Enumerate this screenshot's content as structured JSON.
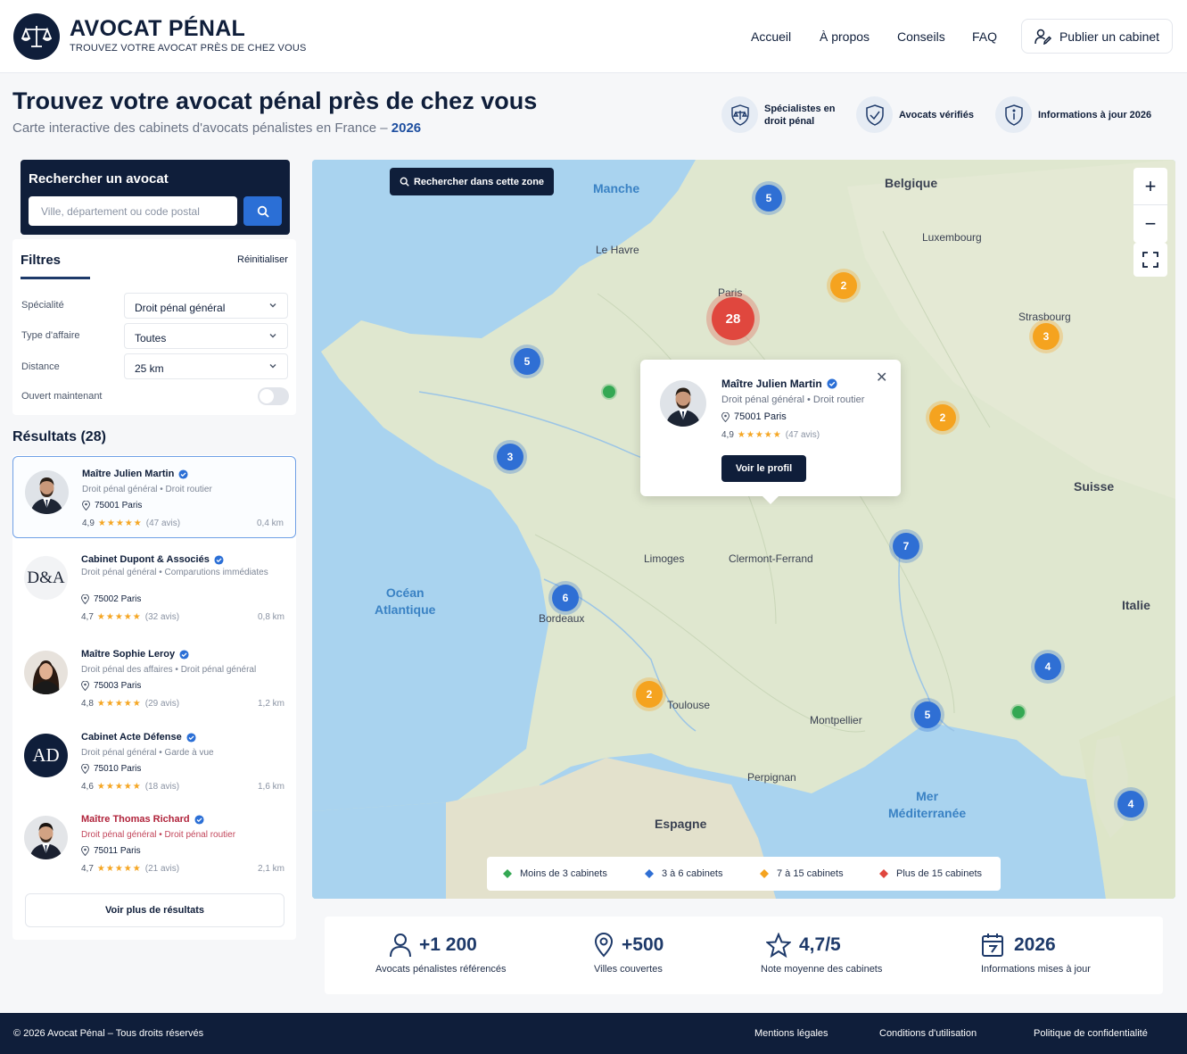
{
  "header": {
    "brand_name": "AVOCAT PÉNAL",
    "brand_tagline": "TROUVEZ VOTRE AVOCAT PRÈS DE CHEZ VOUS",
    "nav": [
      "Accueil",
      "À propos",
      "Conseils",
      "FAQ"
    ],
    "publish_label": "Publier un cabinet"
  },
  "hero": {
    "title": "Trouvez votre avocat pénal près de chez vous",
    "subtitle": "Carte interactive des cabinets d'avocats pénalistes en France –",
    "subtitle_year": "2026",
    "features": [
      {
        "icon": "shield-scale-icon",
        "line1": "Spécialistes en",
        "line2": "droit pénal"
      },
      {
        "icon": "shield-check-icon",
        "line1": "Avocats vérifiés",
        "line2": ""
      },
      {
        "icon": "info-shield-icon",
        "line1": "Informations à jour 2026",
        "line2": ""
      }
    ]
  },
  "search": {
    "title": "Rechercher un avocat",
    "placeholder": "Ville, département ou code postal"
  },
  "filters": {
    "title": "Filtres",
    "reset_label": "Réinitialiser",
    "specialite_label": "Spécialité",
    "specialite_value": "Droit pénal général",
    "type_label": "Type d'affaire",
    "type_value": "Toutes",
    "distance_label": "Distance",
    "distance_value": "25 km",
    "open_label": "Ouvert maintenant",
    "open_enabled": false
  },
  "results": {
    "title": "Résultats (28)",
    "more_label": "Voir plus de résultats",
    "items": [
      {
        "name": "Maître Julien Martin",
        "specialties": "Droit pénal général • Droit routier",
        "address": "75001 Paris",
        "rating": "4,9",
        "stars": "★★★★★",
        "reviews": "(47 avis)",
        "distance": "0,4 km",
        "avatar": "man-suit-photo"
      },
      {
        "name": "Cabinet Dupont & Associés",
        "specialties": "Droit pénal général • Comparutions immédiates",
        "address": "75002 Paris",
        "rating": "4,7",
        "stars": "★★★★★",
        "reviews": "(32 avis)",
        "distance": "0,8 km",
        "avatar": "D&A"
      },
      {
        "name": "Maître Sophie Leroy",
        "specialties": "Droit pénal des affaires • Droit pénal général",
        "address": "75003 Paris",
        "rating": "4,8",
        "stars": "★★★★★",
        "reviews": "(29 avis)",
        "distance": "1,2 km",
        "avatar": "woman-photo"
      },
      {
        "name": "Cabinet Acte Défense",
        "specialties": "Droit pénal général • Garde à vue",
        "address": "75010 Paris",
        "rating": "4,6",
        "stars": "★★★★★",
        "reviews": "(18 avis)",
        "distance": "1,6 km",
        "avatar": "AD"
      },
      {
        "name": "Maître Thomas Richard",
        "specialties": "Droit pénal général • Droit pénal routier",
        "address": "75011 Paris",
        "rating": "4,7",
        "stars": "★★★★★",
        "reviews": "(21 avis)",
        "distance": "2,1 km",
        "avatar": "man-suit-photo"
      }
    ]
  },
  "map": {
    "search_zone_label": "Rechercher dans cette zone",
    "labels": {
      "manche": "Manche",
      "belgique": "Belgique",
      "luxembourg": "Luxembourg",
      "le_havre": "Le Havre",
      "paris": "Paris",
      "strasbourg": "Strasbourg",
      "suisse": "Suisse",
      "limoges": "Limoges",
      "clermont": "Clermont-Ferrand",
      "ocean": "Océan",
      "atlantique": "Atlantique",
      "bordeaux": "Bordeaux",
      "italie": "Italie",
      "toulouse": "Toulouse",
      "montpellier": "Montpellier",
      "perpignan": "Perpignan",
      "espagne": "Espagne",
      "mer": "Mer",
      "mediterranee": "Méditerranée"
    },
    "clusters": [
      {
        "count": "5",
        "level": "blue"
      },
      {
        "count": "28",
        "level": "red"
      },
      {
        "count": "2",
        "level": "orange"
      },
      {
        "count": "3",
        "level": "orange"
      },
      {
        "count": "5",
        "level": "blue"
      },
      {
        "count": "3",
        "level": "blue"
      },
      {
        "count": "2",
        "level": "orange"
      },
      {
        "count": "7",
        "level": "blue"
      },
      {
        "count": "6",
        "level": "blue"
      },
      {
        "count": "2",
        "level": "orange"
      },
      {
        "count": "4",
        "level": "blue"
      },
      {
        "count": "5",
        "level": "blue"
      },
      {
        "count": "4",
        "level": "blue"
      }
    ],
    "popup": {
      "name": "Maître Julien Martin",
      "specialties": "Droit pénal général • Droit routier",
      "address": "75001 Paris",
      "rating": "4,9",
      "stars": "★★★★★",
      "reviews": "(47 avis)",
      "button_label": "Voir le profil"
    },
    "legend": [
      {
        "label": "Moins de 3 cabinets",
        "color": "#34a853"
      },
      {
        "label": "3 à 6 cabinets",
        "color": "#2f6fd4"
      },
      {
        "label": "7 à 15 cabinets",
        "color": "#f5a31f"
      },
      {
        "label": "Plus de 15 cabinets",
        "color": "#e0473e"
      }
    ]
  },
  "stats": [
    {
      "value": "+1 200",
      "label": "Avocats pénalistes référencés",
      "icon": "person-icon"
    },
    {
      "value": "+500",
      "label": "Villes couvertes",
      "icon": "map-pin-icon"
    },
    {
      "value": "4,7/5",
      "label": "Note moyenne des cabinets",
      "icon": "star-icon"
    },
    {
      "value": "2026",
      "label": "Informations mises à jour",
      "icon": "calendar-icon"
    }
  ],
  "footer": {
    "copyright": "© 2026 Avocat Pénal – Tous droits réservés",
    "links": [
      "Mentions légales",
      "Conditions d'utilisation",
      "Politique de confidentialité"
    ]
  },
  "colors": {
    "navy": "#0f1e3a",
    "accent_blue": "#2b6fd6",
    "star": "#f5a623"
  }
}
